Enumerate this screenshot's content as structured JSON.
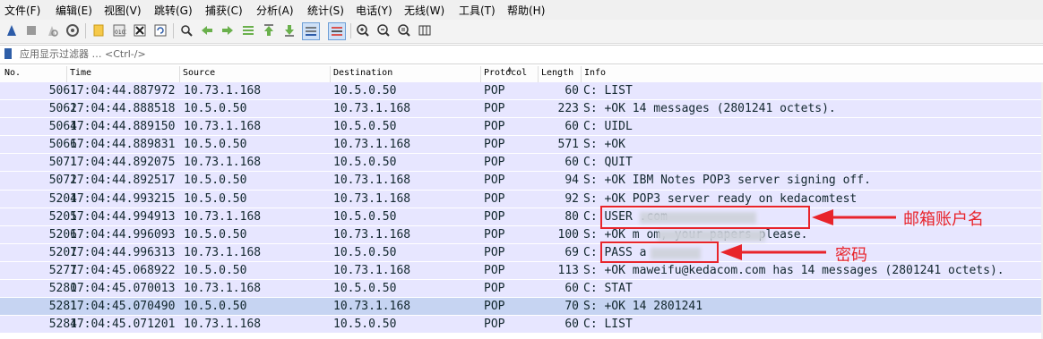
{
  "menu": [
    "文件(F)",
    "编辑(E)",
    "视图(V)",
    "跳转(G)",
    "捕获(C)",
    "分析(A)",
    "统计(S)",
    "电话(Y)",
    "无线(W)",
    "工具(T)",
    "帮助(H)"
  ],
  "filter": {
    "placeholder": "应用显示过滤器 … <Ctrl-/>"
  },
  "columns": {
    "no": "No.",
    "time": "Time",
    "source": "Source",
    "destination": "Destination",
    "protocol": "Protocol",
    "length": "Length",
    "info": "Info"
  },
  "packets": [
    {
      "no": "5061",
      "time": "17:04:44.887972",
      "source": "10.73.1.168",
      "destination": "10.5.0.50",
      "protocol": "POP",
      "length": "60",
      "info": "C: LIST"
    },
    {
      "no": "5062",
      "time": "17:04:44.888518",
      "source": "10.5.0.50",
      "destination": "10.73.1.168",
      "protocol": "POP",
      "length": "223",
      "info": "S: +OK 14 messages (2801241 octets)."
    },
    {
      "no": "5064",
      "time": "17:04:44.889150",
      "source": "10.73.1.168",
      "destination": "10.5.0.50",
      "protocol": "POP",
      "length": "60",
      "info": "C: UIDL"
    },
    {
      "no": "5066",
      "time": "17:04:44.889831",
      "source": "10.5.0.50",
      "destination": "10.73.1.168",
      "protocol": "POP",
      "length": "571",
      "info": "S: +OK"
    },
    {
      "no": "5071",
      "time": "17:04:44.892075",
      "source": "10.73.1.168",
      "destination": "10.5.0.50",
      "protocol": "POP",
      "length": "60",
      "info": "C: QUIT"
    },
    {
      "no": "5072",
      "time": "17:04:44.892517",
      "source": "10.5.0.50",
      "destination": "10.73.1.168",
      "protocol": "POP",
      "length": "94",
      "info": "S: +OK IBM Notes POP3 server signing off."
    },
    {
      "no": "5204",
      "time": "17:04:44.993215",
      "source": "10.5.0.50",
      "destination": "10.73.1.168",
      "protocol": "POP",
      "length": "92",
      "info": "S: +OK POP3 server ready on kedacomtest"
    },
    {
      "no": "5205",
      "time": "17:04:44.994913",
      "source": "10.73.1.168",
      "destination": "10.5.0.50",
      "protocol": "POP",
      "length": "80",
      "info": "C: USER                 .com"
    },
    {
      "no": "5206",
      "time": "17:04:44.996093",
      "source": "10.5.0.50",
      "destination": "10.73.1.168",
      "protocol": "POP",
      "length": "100",
      "info": "S: +OK m               om, your papers please."
    },
    {
      "no": "5207",
      "time": "17:04:44.996313",
      "source": "10.73.1.168",
      "destination": "10.5.0.50",
      "protocol": "POP",
      "length": "69",
      "info": "C: PASS a"
    },
    {
      "no": "5277",
      "time": "17:04:45.068922",
      "source": "10.5.0.50",
      "destination": "10.73.1.168",
      "protocol": "POP",
      "length": "113",
      "info": "S: +OK maweifu@kedacom.com has 14 messages (2801241 octets)."
    },
    {
      "no": "5280",
      "time": "17:04:45.070013",
      "source": "10.73.1.168",
      "destination": "10.5.0.50",
      "protocol": "POP",
      "length": "60",
      "info": "C: STAT"
    },
    {
      "no": "5281",
      "time": "17:04:45.070490",
      "source": "10.5.0.50",
      "destination": "10.73.1.168",
      "protocol": "POP",
      "length": "70",
      "info": "S: +OK 14 2801241"
    },
    {
      "no": "5284",
      "time": "17:04:45.071201",
      "source": "10.73.1.168",
      "destination": "10.5.0.50",
      "protocol": "POP",
      "length": "60",
      "info": "C: LIST"
    }
  ],
  "annotations": {
    "email_account": "邮箱账户名",
    "password": "密码"
  },
  "colors": {
    "row": "#e7e6ff",
    "selected_row": "#c6d4f2",
    "annotation": "#e8242b"
  }
}
